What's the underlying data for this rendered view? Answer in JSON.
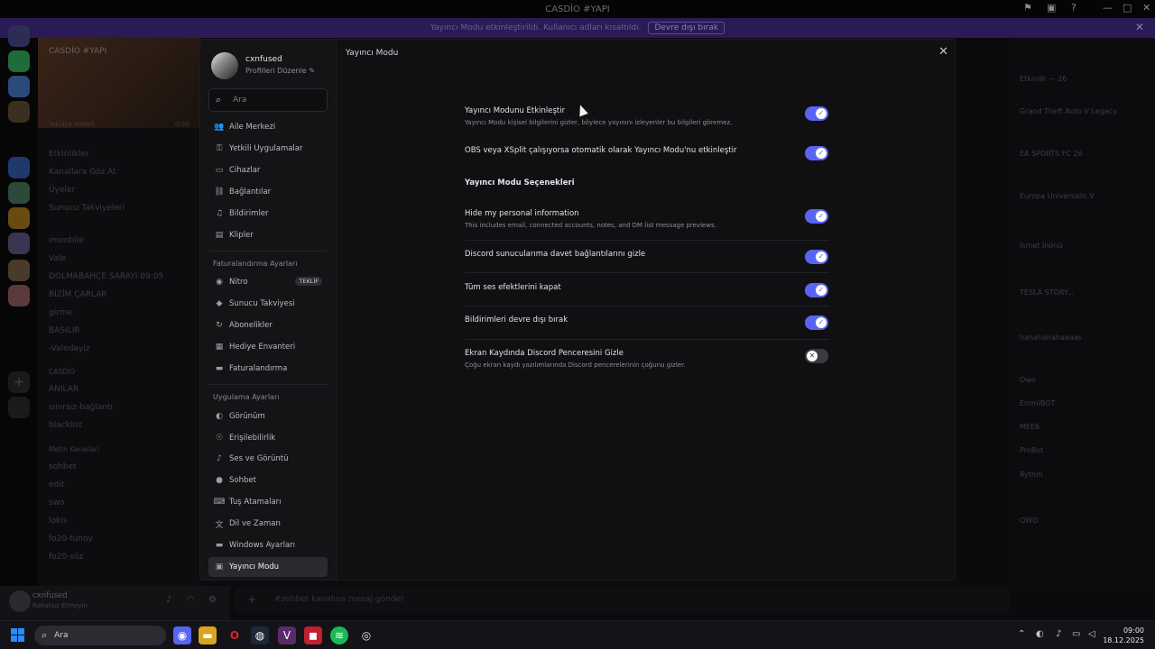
{
  "window": {
    "title": "CASDİO #YAPI"
  },
  "banner": {
    "text": "Yayıncı Modu etkinleştirildi. Kullanıcı adları kısaltıldı.",
    "button": "Devre dışı bırak"
  },
  "background": {
    "server_name": "CASDİO #YAPI",
    "boost_goal": "Takviye Hedefi",
    "boost_count": "0/30",
    "channels": [
      "Etkinlikler",
      "Kanallara Göz At",
      "Üyeler",
      "Sunucu Takviyeleri",
      "imonbile",
      "Vale",
      "DOLMABAHÇE SARAYI 09:05",
      "BİZİM ÇARLAR",
      "girme",
      "BASILIR",
      "-Valodayiz",
      "CASDİO",
      "ANILAR",
      "sınırsız-bağlantı",
      "blacklist",
      "Metin Kanalları",
      "sohbet",
      "edit",
      "swo",
      "lokis",
      "fo20-funny",
      "fo20-söz"
    ],
    "members_header": "Etkinlik — 26",
    "members": [
      "Grand Theft Auto V Legacy",
      "EA SPORTS FC 26",
      "Europa Universalis V",
      "İsmet İnönü",
      "TESLA STORY...",
      "hahahahahaaaas",
      "Owo",
      "EmmiBOT",
      "MEE6",
      "ProBot",
      "Rythm",
      "OWO"
    ],
    "chat_placeholder": "#sohbet kanalına mesaj gönder"
  },
  "user": {
    "name": "cxnfused",
    "edit_label": "Profilleri Düzenle",
    "status": "Rahatsız Etmeyin"
  },
  "sidebar": {
    "search_placeholder": "Ara",
    "group1": [
      {
        "label": "Aile Merkezi",
        "icon": "people-icon"
      },
      {
        "label": "Yetkili Uygulamalar",
        "icon": "key-icon"
      },
      {
        "label": "Cihazlar",
        "icon": "devices-icon"
      },
      {
        "label": "Bağlantılar",
        "icon": "link-icon"
      },
      {
        "label": "Bildirimler",
        "icon": "bell-icon"
      },
      {
        "label": "Klipler",
        "icon": "clips-icon"
      }
    ],
    "billing_header": "Faturalandırma Ayarları",
    "group2": [
      {
        "label": "Nitro",
        "icon": "nitro-icon",
        "badge": "TEKLİF"
      },
      {
        "label": "Sunucu Takviyesi",
        "icon": "boost-icon"
      },
      {
        "label": "Abonelikler",
        "icon": "subscriptions-icon"
      },
      {
        "label": "Hediye Envanteri",
        "icon": "gift-icon"
      },
      {
        "label": "Faturalandırma",
        "icon": "card-icon"
      }
    ],
    "app_header": "Uygulama Ayarları",
    "group3": [
      {
        "label": "Görünüm",
        "icon": "palette-icon"
      },
      {
        "label": "Erişilebilirlik",
        "icon": "accessibility-icon"
      },
      {
        "label": "Ses ve Görüntü",
        "icon": "mic-icon"
      },
      {
        "label": "Sohbet",
        "icon": "chat-icon"
      },
      {
        "label": "Tuş Atamaları",
        "icon": "keyboard-icon"
      },
      {
        "label": "Dil ve Zaman",
        "icon": "language-icon"
      },
      {
        "label": "Windows Ayarları",
        "icon": "monitor-icon"
      },
      {
        "label": "Yayıncı Modu",
        "icon": "streamer-icon"
      }
    ]
  },
  "content": {
    "header": "Yayıncı Modu",
    "rows": [
      {
        "title": "Yayıncı Modunu Etkinleştir",
        "desc": "Yayıncı Modu kişisel bilgilerini gizler, böylece yayınını izleyenler bu bilgileri göremez.",
        "on": true
      },
      {
        "title": "OBS veya XSplit çalışıyorsa otomatik olarak Yayıncı Modu'nu etkinleştir",
        "desc": "",
        "on": true
      }
    ],
    "options_header": "Yayıncı Modu Seçenekleri",
    "options": [
      {
        "title": "Hide my personal information",
        "desc": "This includes email, connected accounts, notes, and DM list message previews.",
        "on": true
      },
      {
        "title": "Discord sunucularıma davet bağlantılarını gizle",
        "desc": "",
        "on": true
      },
      {
        "title": "Tüm ses efektlerini kapat",
        "desc": "",
        "on": true
      },
      {
        "title": "Bildirimleri devre dışı bırak",
        "desc": "",
        "on": true
      },
      {
        "title": "Ekran Kaydında Discord Penceresini Gizle",
        "desc": "Çoğu ekran kaydı yazılımlarında Discord pencerelerinin çoğunu gizler.",
        "on": false
      }
    ]
  },
  "taskbar": {
    "search": "Ara",
    "time": "09:00",
    "date": "18.12.2025"
  }
}
